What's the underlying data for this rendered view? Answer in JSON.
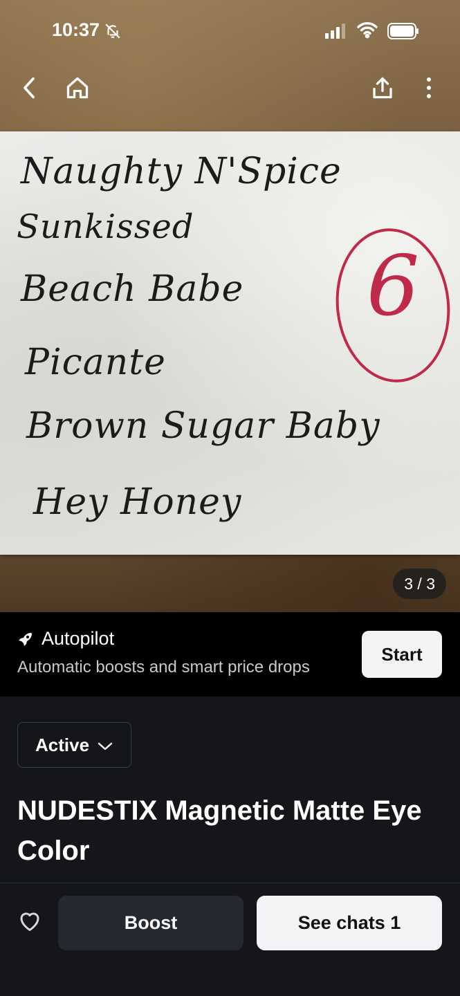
{
  "status_bar": {
    "time": "10:37"
  },
  "photo": {
    "note_lines": [
      "Naughty N'Spice",
      "Sunkissed",
      "Beach Babe",
      "Picante",
      "Brown Sugar Baby",
      "Hey Honey"
    ],
    "circled_number": "6",
    "counter": "3 / 3"
  },
  "autopilot": {
    "title": "Autopilot",
    "subtitle": "Automatic boosts and smart price drops",
    "start_label": "Start"
  },
  "listing": {
    "status": "Active",
    "title": "NUDESTIX Magnetic Matte Eye Color"
  },
  "actions": {
    "boost_label": "Boost",
    "chats_label": "See chats 1"
  }
}
